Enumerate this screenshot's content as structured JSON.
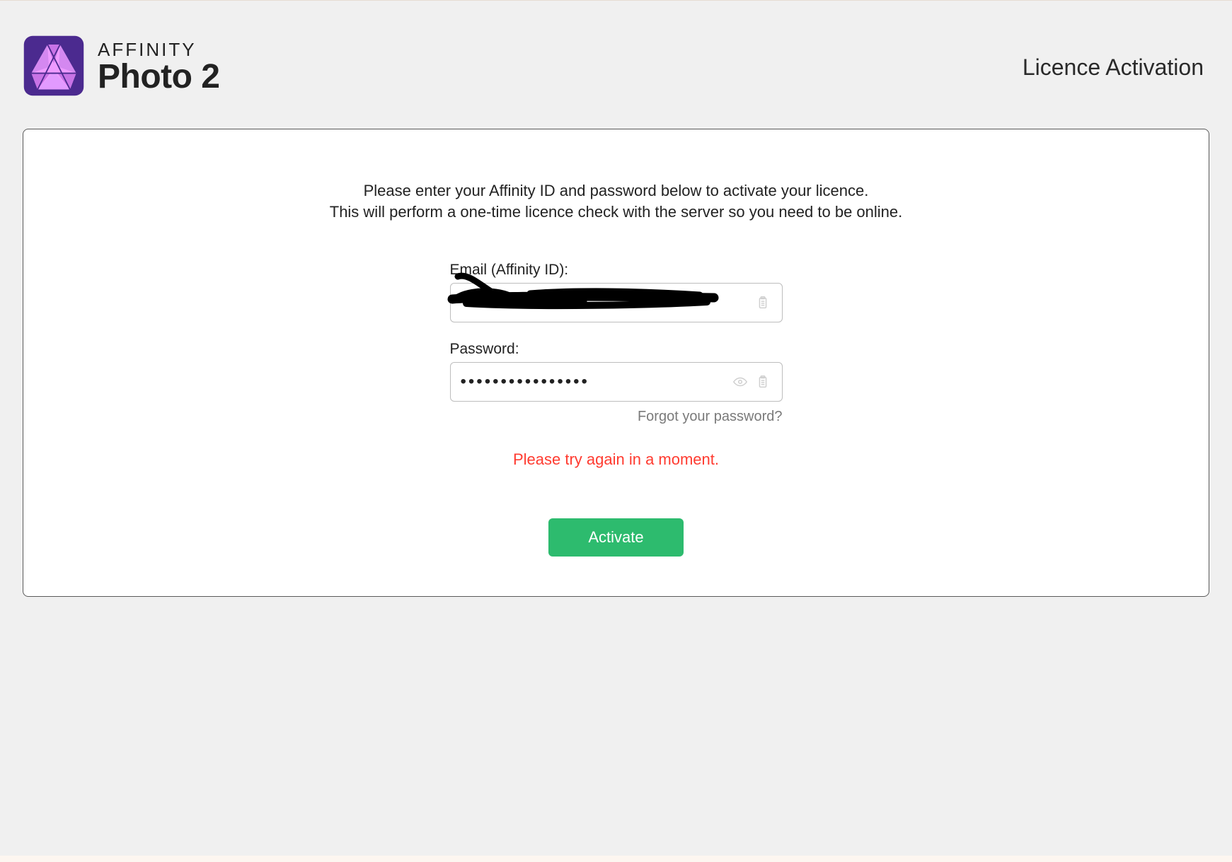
{
  "brand": {
    "line1": "AFFINITY",
    "line2": "Photo 2"
  },
  "header": {
    "title": "Licence Activation"
  },
  "instructions": {
    "line1": "Please enter your Affinity ID and password below to activate your licence.",
    "line2": "This will perform a one-time licence check with the server so you need to be online."
  },
  "form": {
    "email_label": "Email (Affinity ID):",
    "email_value": "",
    "password_label": "Password:",
    "password_value": "••••••••••••••••",
    "forgot_label": "Forgot your password?"
  },
  "error_message": "Please try again in a moment.",
  "buttons": {
    "activate": "Activate"
  },
  "colors": {
    "accent_green": "#2dbb6e",
    "error_red": "#ff3b30",
    "logo_purple_dark": "#4b2a8f",
    "logo_purple_light": "#c873e6",
    "logo_pink": "#ee9bff"
  }
}
